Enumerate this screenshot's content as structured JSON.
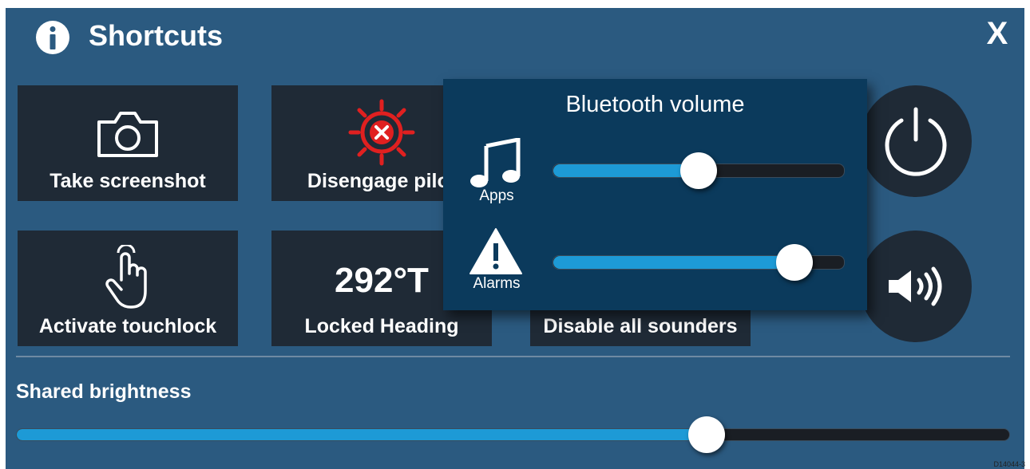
{
  "header": {
    "title": "Shortcuts",
    "close_label": "X",
    "info_icon": "info-icon"
  },
  "tiles": [
    {
      "label": "Take screenshot",
      "icon": "camera-icon"
    },
    {
      "label": "Disengage pilot",
      "icon": "pilot-disengage-icon",
      "icon_color": "#e02020"
    },
    {
      "label": "Activate touchlock",
      "icon": "touch-hand-icon"
    },
    {
      "label": "Locked Heading",
      "value": "292°T"
    },
    {
      "label": "Disable all sounders"
    }
  ],
  "round_buttons": [
    {
      "name": "power",
      "icon": "power-icon"
    },
    {
      "name": "volume",
      "icon": "speaker-icon"
    }
  ],
  "brightness": {
    "label": "Shared brightness",
    "level": 0.695
  },
  "bluetooth": {
    "title": "Bluetooth volume",
    "apps": {
      "label": "Apps",
      "icon": "music-note-icon",
      "level": 0.5
    },
    "alarms": {
      "label": "Alarms",
      "icon": "warning-icon",
      "level": 0.83
    }
  },
  "doc_code": "D14044-3",
  "colors": {
    "background": "#2b5a80",
    "tile": "#1f2a36",
    "panel": "#0b3a5c",
    "slider_fill": "#1d9ad6",
    "slider_track": "#1a1e24",
    "alert_red": "#e02020"
  }
}
